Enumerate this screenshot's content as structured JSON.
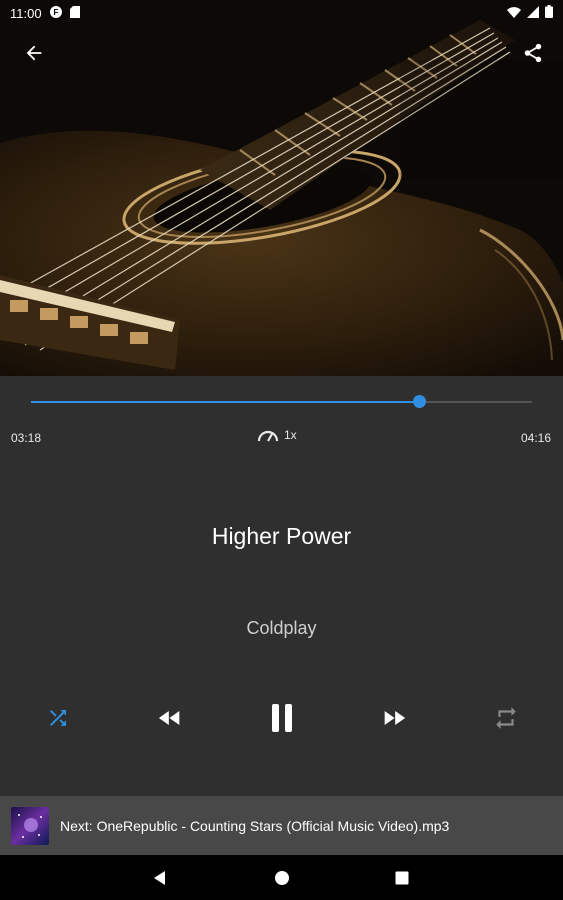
{
  "status_bar": {
    "time": "11:00"
  },
  "player": {
    "current_time": "03:18",
    "duration": "04:16",
    "progress": 0.775,
    "speed": "1x",
    "title": "Higher Power",
    "artist": "Coldplay",
    "shuffle_active": true,
    "accent_color": "#2f8ee0"
  },
  "next": {
    "label": "Next: OneRepublic - Counting Stars (Official Music Video).mp3"
  },
  "icons": {
    "back": "arrow-left-icon",
    "share": "share-icon",
    "speed": "speedometer-icon",
    "shuffle": "shuffle-icon",
    "rewind": "rewind-icon",
    "pause": "pause-icon",
    "forward": "fast-forward-icon",
    "repeat": "repeat-icon"
  }
}
